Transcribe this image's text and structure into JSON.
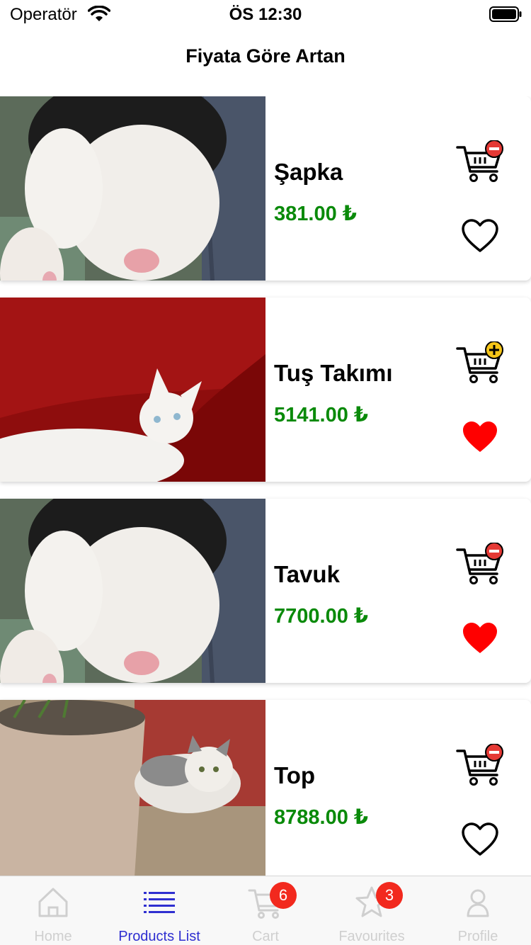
{
  "status_bar": {
    "carrier": "Operatör",
    "time": "ÖS 12:30"
  },
  "header": {
    "title": "Fiyata Göre Artan"
  },
  "products": [
    {
      "name": "Şapka",
      "price": "381.00 ₺",
      "cart_action": "remove",
      "favorite": false,
      "image": "cat-paws-closeup"
    },
    {
      "name": "Tuş Takımı",
      "price": "5141.00 ₺",
      "cart_action": "add",
      "favorite": true,
      "image": "cat-on-red-pillow"
    },
    {
      "name": "Tavuk",
      "price": "7700.00 ₺",
      "cart_action": "remove",
      "favorite": true,
      "image": "cat-paws-closeup"
    },
    {
      "name": "Top",
      "price": "8788.00 ₺",
      "cart_action": "remove",
      "favorite": false,
      "image": "cat-beside-flower-pot"
    }
  ],
  "tab_bar": {
    "tabs": [
      {
        "label": "Home",
        "icon": "home-icon"
      },
      {
        "label": "Products List",
        "icon": "list-icon",
        "active": true
      },
      {
        "label": "Cart",
        "icon": "cart-icon",
        "badge": "6"
      },
      {
        "label": "Favourites",
        "icon": "star-icon",
        "badge": "3"
      },
      {
        "label": "Profile",
        "icon": "profile-icon"
      }
    ]
  },
  "colors": {
    "price": "#0a8a0a",
    "active_tab": "#2f2fd0",
    "badge": "#f2291e",
    "heart_filled": "#ff0000",
    "cart_add": "#f5c518",
    "cart_remove": "#e53935"
  }
}
